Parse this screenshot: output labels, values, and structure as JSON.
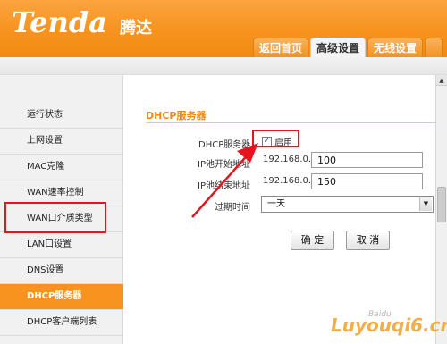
{
  "brand": {
    "logo": "Tenda",
    "logo_cn": "腾达"
  },
  "tabs": [
    {
      "label": "返回首页",
      "active": false
    },
    {
      "label": "高级设置",
      "active": true
    },
    {
      "label": "无线设置",
      "active": false
    },
    {
      "label": "",
      "active": false
    }
  ],
  "sidebar": {
    "items": [
      {
        "label": "运行状态"
      },
      {
        "label": "上网设置"
      },
      {
        "label": "MAC克隆"
      },
      {
        "label": "WAN速率控制"
      },
      {
        "label": "WAN口介质类型"
      },
      {
        "label": "LAN口设置"
      },
      {
        "label": "DNS设置"
      },
      {
        "label": "DHCP服务器",
        "active": true
      },
      {
        "label": "DHCP客户端列表"
      }
    ]
  },
  "main": {
    "title": "DHCP服务器",
    "dhcp_label": "DHCP服务器",
    "enable_label": "启用",
    "enable_checked": true,
    "start_label": "IP池开始地址",
    "end_label": "IP池结束地址",
    "ip_prefix": "192.168.0.",
    "start_value": "100",
    "end_value": "150",
    "expire_label": "过期时间",
    "expire_value": "一天",
    "ok_label": "确 定",
    "cancel_label": "取 消"
  },
  "watermark": {
    "text": "Luyouqi6.cn",
    "baidu": "Baidu"
  },
  "colors": {
    "brand_orange": "#f7931e",
    "annotation_red": "#e4151f"
  }
}
